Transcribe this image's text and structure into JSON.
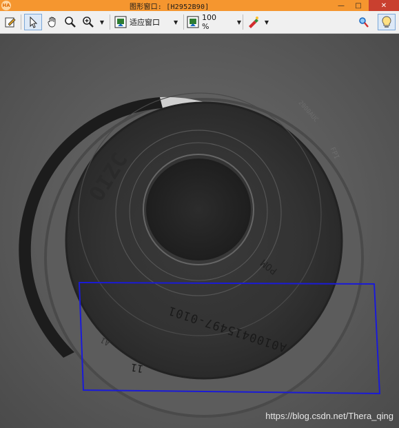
{
  "window": {
    "title": "图形窗口: [H2952B90]",
    "app_icon": "HA",
    "minimize": "—",
    "maximize": "□",
    "close": "✕"
  },
  "toolbar": {
    "tools": [
      {
        "name": "edit-icon"
      },
      {
        "name": "pointer-icon"
      },
      {
        "name": "hand-icon"
      },
      {
        "name": "magnifier-icon"
      },
      {
        "name": "zoom-in-icon"
      },
      {
        "name": "image-fit-icon"
      },
      {
        "name": "zoom-percent-icon"
      },
      {
        "name": "color-tool-icon"
      },
      {
        "name": "inspect-icon"
      },
      {
        "name": "lightbulb-icon"
      }
    ],
    "fit_label": "适应窗口",
    "zoom_label": "100 %"
  },
  "image": {
    "part_code": "A0100415497-0101",
    "mark_11": "11",
    "mark_a1": "A1",
    "ring_text": "POM",
    "logo_text": "OIZC",
    "rim_text_1": "2000AUC",
    "rim_text_2": "FPI",
    "watermark": "https://blog.csdn.net/Thera_qing",
    "roi_color": "#1a1ad8"
  }
}
